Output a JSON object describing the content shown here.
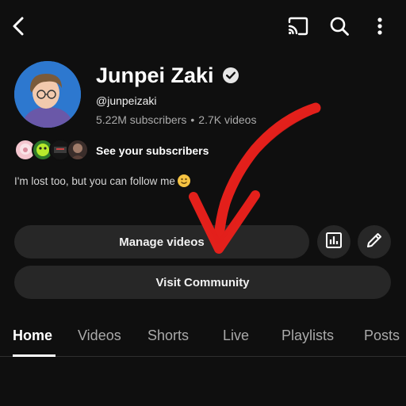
{
  "icons": {
    "back": "back-arrow-icon",
    "cast": "cast-icon",
    "search": "search-icon",
    "more": "more-vertical-icon",
    "verified": "verified-check-icon",
    "analytics": "analytics-icon",
    "edit": "pencil-icon"
  },
  "channel": {
    "name": "Junpei Zaki",
    "handle": "@junpeizaki",
    "subscribers": "5.22M subscribers",
    "separator": "•",
    "videos": "2.7K videos",
    "see_subscribers": "See your subscribers",
    "bio": "I'm lost too, but you can follow me"
  },
  "actions": {
    "manage_videos": "Manage videos",
    "visit_community": "Visit Community"
  },
  "tabs": [
    {
      "label": "Home",
      "active": true
    },
    {
      "label": "Videos",
      "active": false
    },
    {
      "label": "Shorts",
      "active": false
    },
    {
      "label": "Live",
      "active": false
    },
    {
      "label": "Playlists",
      "active": false
    },
    {
      "label": "Posts",
      "active": false
    }
  ],
  "colors": {
    "background": "#0f0f0f",
    "button_bg": "#272727",
    "secondary_text": "#aaaaaa",
    "annotation_arrow": "#e3201b"
  }
}
